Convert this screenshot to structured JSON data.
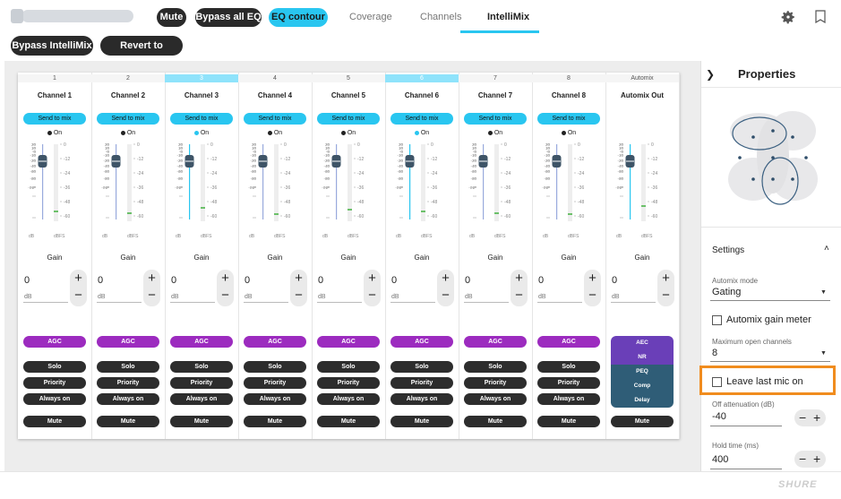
{
  "topbar": {
    "buttons": {
      "mute": "Mute",
      "bypass_eq": "Bypass all EQ",
      "eq_contour": "EQ contour"
    },
    "tabs": [
      "Coverage",
      "Channels",
      "IntelliMix"
    ],
    "active_tab": "IntelliMix",
    "icons": [
      "gear-icon",
      "bookmark-icon"
    ]
  },
  "toolbar": {
    "bypass_intellimix": "Bypass IntelliMix",
    "revert": "Revert to defaults"
  },
  "channels": [
    {
      "num": "1",
      "name": "Channel 1",
      "on_active": false
    },
    {
      "num": "2",
      "name": "Channel 2",
      "on_active": false
    },
    {
      "num": "3",
      "name": "Channel 3",
      "on_active": true
    },
    {
      "num": "4",
      "name": "Channel 4",
      "on_active": false
    },
    {
      "num": "5",
      "name": "Channel 5",
      "on_active": false
    },
    {
      "num": "6",
      "name": "Channel 6",
      "on_active": true
    },
    {
      "num": "7",
      "name": "Channel 7",
      "on_active": false
    },
    {
      "num": "8",
      "name": "Channel 8",
      "on_active": false
    }
  ],
  "automix": {
    "num": "Automix",
    "name": "Automix Out",
    "stack": [
      "AEC",
      "NR",
      "PEQ",
      "Comp",
      "Delay"
    ],
    "mute": "Mute"
  },
  "strip": {
    "send_to_mix": "Send to mix",
    "on": "On",
    "gain": "Gain",
    "gain_value": "0",
    "gain_unit": "dB",
    "fader_scale": [
      "20",
      "10",
      "0",
      "-10",
      "-20",
      "-40",
      "-60",
      "-80",
      "-INF"
    ],
    "meter_scale": [
      "0",
      "-12",
      "-24",
      "-36",
      "-48",
      "-60"
    ],
    "fader_unit": "dB",
    "meter_unit": "dBFS",
    "agc": "AGC",
    "solo": "Solo",
    "priority": "Priority",
    "always_on": "Always on",
    "mute": "Mute"
  },
  "properties": {
    "title": "Properties",
    "settings": "Settings",
    "automix_mode_label": "Automix mode",
    "automix_mode_value": "Gating",
    "automix_gain_meter": "Automix gain meter",
    "max_open_label": "Maximum open channels",
    "max_open_value": "8",
    "leave_last_mic": "Leave last mic on",
    "off_atten_label": "Off attenuation (dB)",
    "off_atten_value": "-40",
    "hold_time_label": "Hold time (ms)",
    "hold_time_value": "400"
  },
  "footer": {
    "logo": "SHURE"
  },
  "colors": {
    "accent": "#29c6f0",
    "agc": "#9c2bbf",
    "highlight": "#f08c1e",
    "automix_purple": "#6a3fb8",
    "automix_blue": "#2f5d77"
  }
}
